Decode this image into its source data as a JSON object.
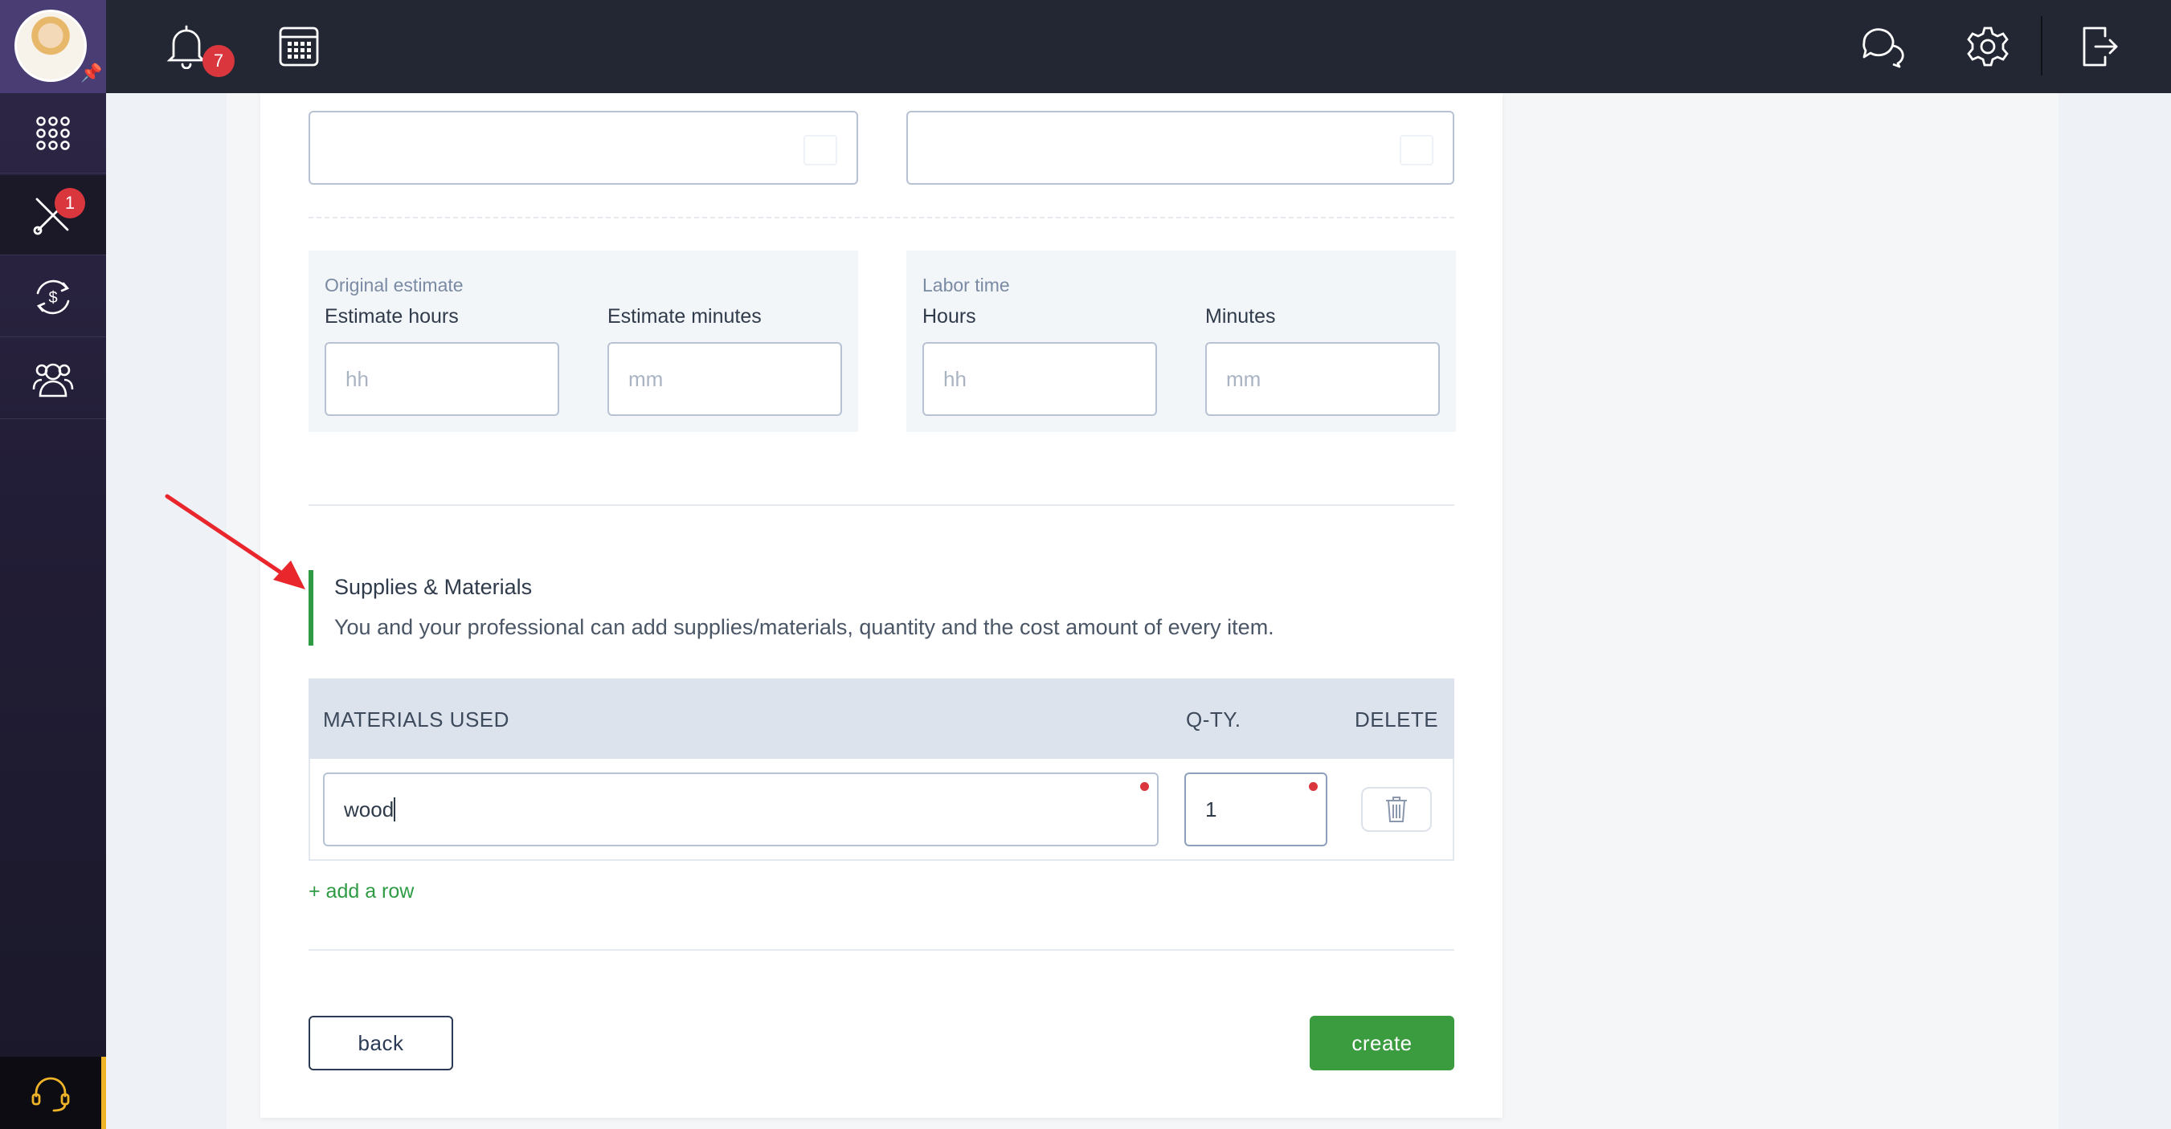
{
  "topbar": {
    "notifications_count": "7"
  },
  "sidebar": {
    "jobs_badge": "1"
  },
  "estimate": {
    "section_label": "Original estimate",
    "hours_label": "Estimate hours",
    "hours_placeholder": "hh",
    "minutes_label": "Estimate minutes",
    "minutes_placeholder": "mm"
  },
  "labor": {
    "section_label": "Labor time",
    "hours_label": "Hours",
    "hours_placeholder": "hh",
    "minutes_label": "Minutes",
    "minutes_placeholder": "mm"
  },
  "supplies": {
    "title": "Supplies & Materials",
    "description": "You and your professional can add supplies/materials, quantity and the cost amount of every item."
  },
  "materials_table": {
    "headers": [
      "MATERIALS USED",
      "Q-TY.",
      "DELETE"
    ],
    "rows": [
      {
        "material": "wood",
        "qty": "1"
      }
    ]
  },
  "add_row_label": "+ add a row",
  "buttons": {
    "back": "back",
    "create": "create"
  },
  "colors": {
    "accent_green": "#3a9b3f",
    "badge_red": "#d9363e",
    "topbar": "#222733"
  }
}
